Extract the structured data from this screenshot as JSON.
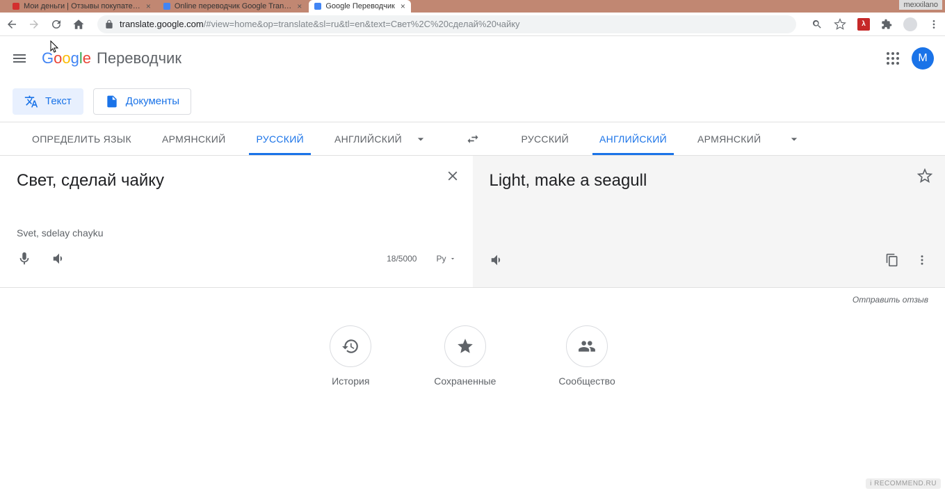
{
  "chrome": {
    "tabs": [
      {
        "title": "Мои деньги | Отзывы покупате…"
      },
      {
        "title": "Online переводчик Google Tran…"
      },
      {
        "title": "Google Переводчик"
      }
    ],
    "user_label": "mexxilano",
    "url_host": "translate.google.com",
    "url_rest": "/#view=home&op=translate&sl=ru&tl=en&text=Свет%2C%20сделай%20чайку"
  },
  "header": {
    "logo": {
      "g1": "G",
      "o1": "o",
      "o2": "o",
      "g2": "g",
      "l": "l",
      "e": "e"
    },
    "app_title": "Переводчик",
    "avatar_initial": "M"
  },
  "modes": {
    "text": "Текст",
    "docs": "Документы"
  },
  "langs": {
    "source": {
      "detect": "ОПРЕДЕЛИТЬ ЯЗЫК",
      "armenian": "АРМЯНСКИЙ",
      "russian": "РУССКИЙ",
      "english": "АНГЛИЙСКИЙ"
    },
    "target": {
      "russian": "РУССКИЙ",
      "english": "АНГЛИЙСКИЙ",
      "armenian": "АРМЯНСКИЙ"
    }
  },
  "translation": {
    "source_text": "Свет, сделай чайку",
    "transliteration": "Svet, sdelay chayku",
    "target_text": "Light, make a seagull",
    "char_count": "18/5000",
    "keyboard": "Ру"
  },
  "feedback": "Отправить отзыв",
  "actions": {
    "history": "История",
    "saved": "Сохраненные",
    "community": "Сообщество"
  },
  "watermark": "i RECOMMEND.RU"
}
